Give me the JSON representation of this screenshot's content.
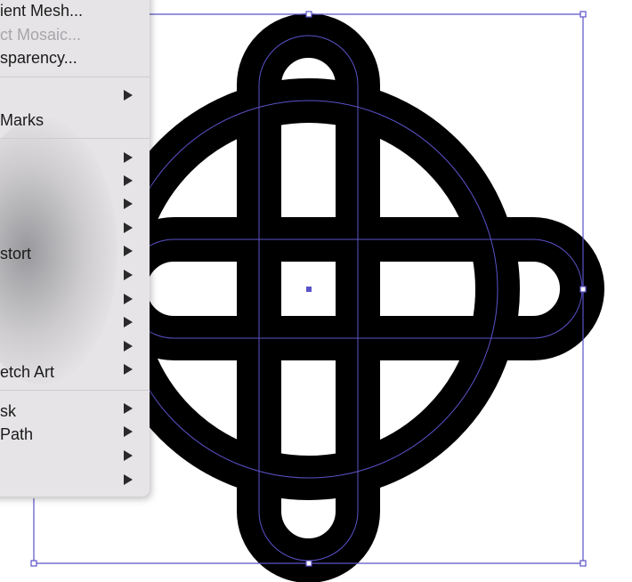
{
  "menu": {
    "items": [
      {
        "label": "ient Mesh...",
        "enabled": true
      },
      {
        "label": "ct Mosaic...",
        "enabled": false
      },
      {
        "label": "sparency...",
        "enabled": true
      },
      {
        "label": "Marks",
        "enabled": true
      },
      {
        "label": "stort",
        "enabled": true
      },
      {
        "label": "etch Art",
        "enabled": true
      },
      {
        "label": "sk",
        "enabled": true
      },
      {
        "label": "Path",
        "enabled": true
      }
    ]
  },
  "colors": {
    "artwork_fill": "#000000",
    "selection": "#5a52c8",
    "menu_background": "#e6e4e6"
  }
}
